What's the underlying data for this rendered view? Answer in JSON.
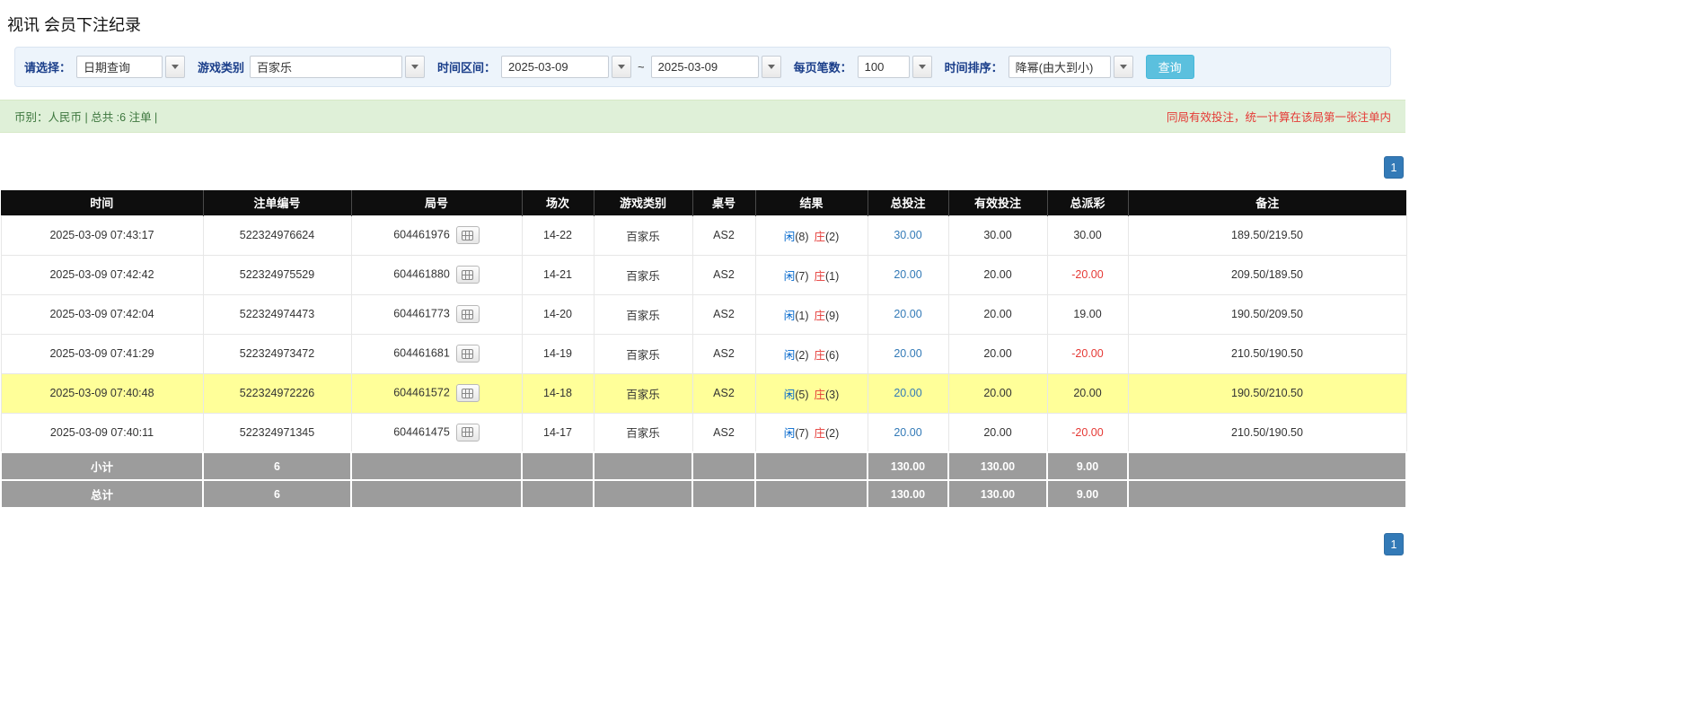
{
  "page": {
    "title": "视讯 会员下注纪录"
  },
  "filters": {
    "query_type_label": "请选择：",
    "query_type_value": "日期查询",
    "game_type_label": "游戏类别",
    "game_type_value": "百家乐",
    "time_range_label": "时间区间：",
    "date_from": "2025-03-09",
    "date_to": "2025-03-09",
    "range_separator": "~",
    "page_size_label": "每页笔数：",
    "page_size_value": "100",
    "sort_label": "时间排序：",
    "sort_value": "降幂(由大到小)",
    "search_button_label": "查询"
  },
  "summary": {
    "left": "币别：人民币 | 总共 :6 注单 |",
    "right": "同局有效投注，统一计算在该局第一张注单内"
  },
  "pagination": {
    "current_page": "1"
  },
  "table": {
    "headers": [
      "时间",
      "注单编号",
      "局号",
      "场次",
      "游戏类别",
      "桌号",
      "结果",
      "总投注",
      "有效投注",
      "总派彩",
      "备注"
    ],
    "rows": [
      {
        "time": "2025-03-09 07:43:17",
        "bet_id": "522324976624",
        "round_id": "604461976",
        "session": "14-22",
        "game": "百家乐",
        "table_no": "AS2",
        "result_p": "闲",
        "result_p_num": "(8)",
        "result_b": "庄",
        "result_b_num": "(2)",
        "total_bet": "30.00",
        "valid_bet": "30.00",
        "payout": "30.00",
        "remark": "189.50/219.50",
        "highlight": false
      },
      {
        "time": "2025-03-09 07:42:42",
        "bet_id": "522324975529",
        "round_id": "604461880",
        "session": "14-21",
        "game": "百家乐",
        "table_no": "AS2",
        "result_p": "闲",
        "result_p_num": "(7)",
        "result_b": "庄",
        "result_b_num": "(1)",
        "total_bet": "20.00",
        "valid_bet": "20.00",
        "payout": "-20.00",
        "remark": "209.50/189.50",
        "highlight": false
      },
      {
        "time": "2025-03-09 07:42:04",
        "bet_id": "522324974473",
        "round_id": "604461773",
        "session": "14-20",
        "game": "百家乐",
        "table_no": "AS2",
        "result_p": "闲",
        "result_p_num": "(1)",
        "result_b": "庄",
        "result_b_num": "(9)",
        "total_bet": "20.00",
        "valid_bet": "20.00",
        "payout": "19.00",
        "remark": "190.50/209.50",
        "highlight": false
      },
      {
        "time": "2025-03-09 07:41:29",
        "bet_id": "522324973472",
        "round_id": "604461681",
        "session": "14-19",
        "game": "百家乐",
        "table_no": "AS2",
        "result_p": "闲",
        "result_p_num": "(2)",
        "result_b": "庄",
        "result_b_num": "(6)",
        "total_bet": "20.00",
        "valid_bet": "20.00",
        "payout": "-20.00",
        "remark": "210.50/190.50",
        "highlight": false
      },
      {
        "time": "2025-03-09 07:40:48",
        "bet_id": "522324972226",
        "round_id": "604461572",
        "session": "14-18",
        "game": "百家乐",
        "table_no": "AS2",
        "result_p": "闲",
        "result_p_num": "(5)",
        "result_b": "庄",
        "result_b_num": "(3)",
        "total_bet": "20.00",
        "valid_bet": "20.00",
        "payout": "20.00",
        "remark": "190.50/210.50",
        "highlight": true
      },
      {
        "time": "2025-03-09 07:40:11",
        "bet_id": "522324971345",
        "round_id": "604461475",
        "session": "14-17",
        "game": "百家乐",
        "table_no": "AS2",
        "result_p": "闲",
        "result_p_num": "(7)",
        "result_b": "庄",
        "result_b_num": "(2)",
        "total_bet": "20.00",
        "valid_bet": "20.00",
        "payout": "-20.00",
        "remark": "210.50/190.50",
        "highlight": false
      }
    ],
    "subtotal": {
      "label": "小计",
      "count": "6",
      "total_bet": "130.00",
      "valid_bet": "130.00",
      "payout": "9.00"
    },
    "grand_total": {
      "label": "总计",
      "count": "6",
      "total_bet": "130.00",
      "valid_bet": "130.00",
      "payout": "9.00"
    }
  },
  "colors": {
    "header_bg": "#0e0e0e",
    "highlight_row": "#ffff99",
    "footer_row_bg": "#9c9c9c",
    "link_blue": "#337ab7",
    "player_blue": "#0066cc",
    "banker_red": "#e53935",
    "negative_red": "#e53935",
    "notice_red": "#e53935",
    "search_button_bg": "#5bc0de",
    "summary_bg": "#dff0d8",
    "filter_bar_bg": "#edf4fb",
    "pager_bg": "#337ab7"
  }
}
